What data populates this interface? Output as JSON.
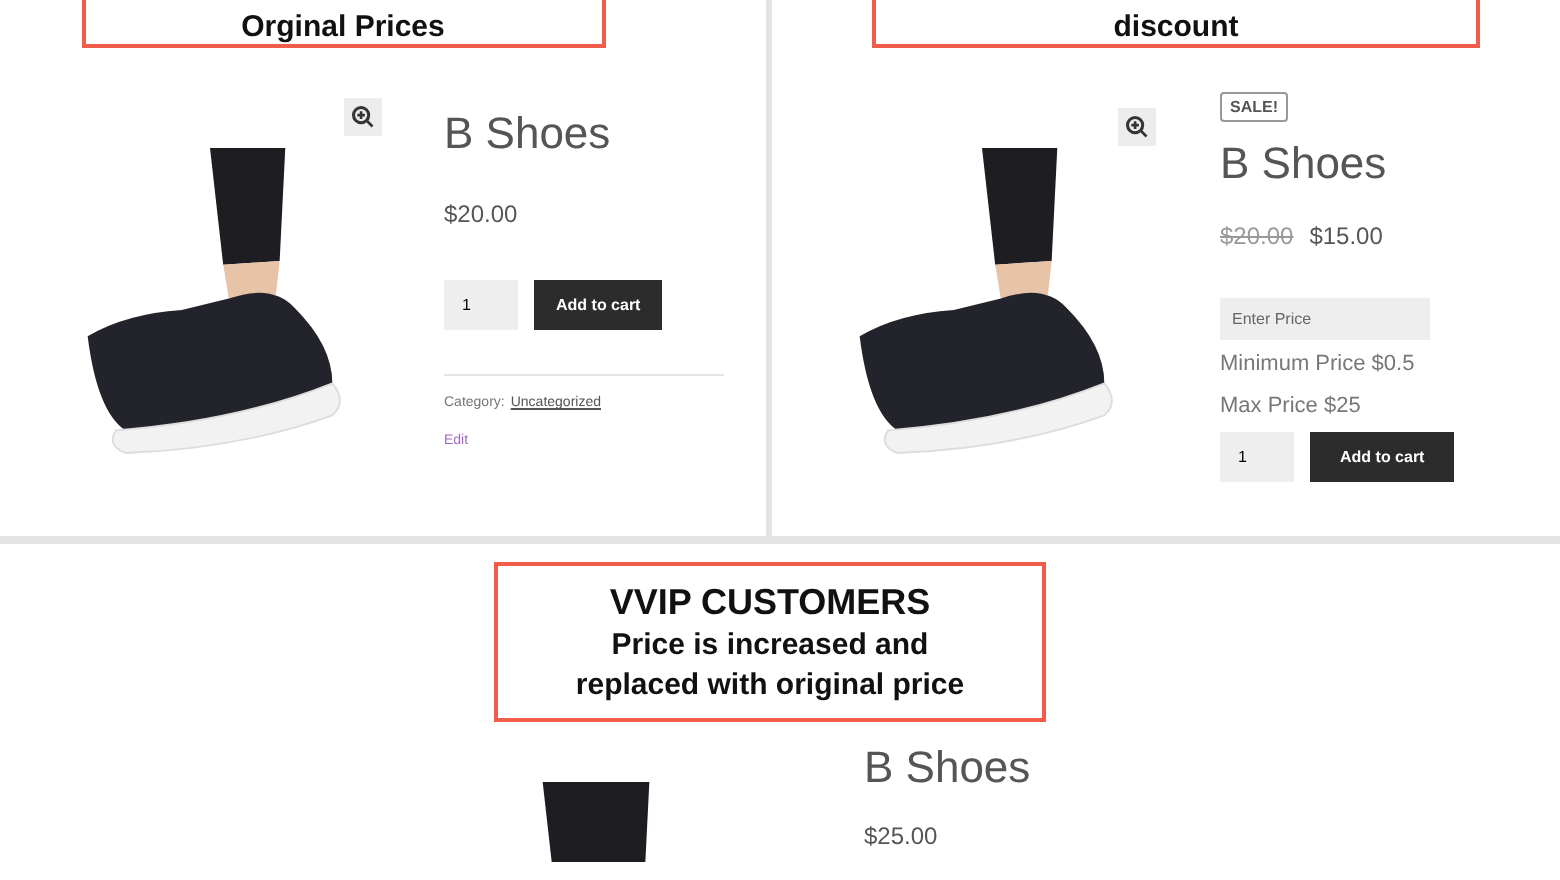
{
  "panels": [
    {
      "callout": [
        "Orginal Prices"
      ],
      "title": "B Shoes",
      "price": "$20.00",
      "quantity": "1",
      "button": "Add to cart",
      "category_label": "Category:",
      "category_link": "Uncategorized",
      "edit_link": "Edit"
    },
    {
      "callout": [
        "discount"
      ],
      "title": "B Shoes",
      "badge": "SALE!",
      "old_price": "$20.00",
      "price": "$15.00",
      "price_field": {
        "placeholder": "Enter Price"
      },
      "notes": [
        "Minimum Price $0.5",
        "Max Price $25"
      ],
      "quantity": "1",
      "button": "Add to cart"
    },
    {
      "callout": [
        "VVIP CUSTOMERS",
        "Price is increased and",
        "replaced with original price"
      ],
      "title": "B Shoes",
      "price": "$25.00"
    }
  ]
}
